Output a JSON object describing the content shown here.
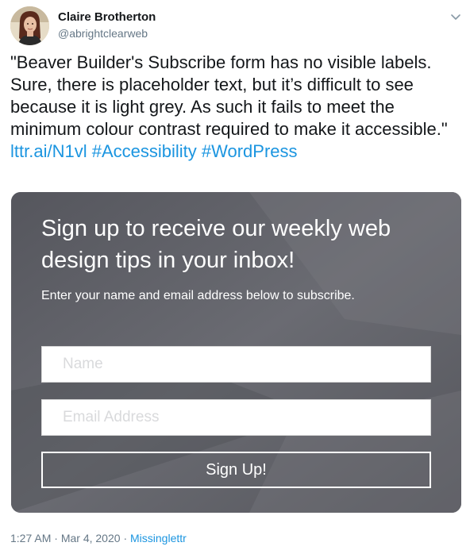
{
  "author": {
    "display_name": "Claire Brotherton",
    "handle": "@abrightclearweb"
  },
  "icons": {
    "avatar": "profile-photo",
    "menu": "chevron-down-icon"
  },
  "tweet": {
    "text": "\"Beaver Builder's Subscribe form has no visible labels. Sure, there is placeholder text, but it’s difficult to see because it is light grey. As such it fails to meet the minimum colour contrast required to make it accessible.\"",
    "links": [
      "lttr.ai/N1vl",
      "#Accessibility",
      "#WordPress"
    ]
  },
  "subscribe_form": {
    "heading": "Sign up to receive our weekly web design tips in your inbox!",
    "subheading": "Enter your name and email address below to subscribe.",
    "name_placeholder": "Name",
    "email_placeholder": "Email Address",
    "button_label": "Sign Up!"
  },
  "footer": {
    "time": "1:27 AM",
    "separator_1": "·",
    "date": "Mar 4, 2020",
    "separator_2": "·",
    "source": "Missinglettr"
  },
  "colors": {
    "text": "#14171a",
    "secondary": "#657786",
    "link": "#1b95e0",
    "media_background": "#5d5e65",
    "placeholder": "#d9dadc"
  }
}
